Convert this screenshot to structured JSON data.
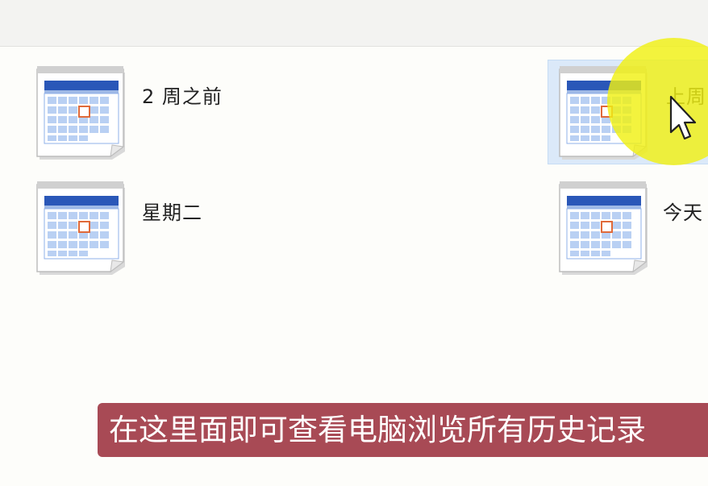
{
  "window": {
    "topbar": ""
  },
  "items": [
    {
      "label": "2 周之前",
      "icon": "calendar-icon"
    },
    {
      "label": "上周",
      "icon": "calendar-icon",
      "selected": true
    },
    {
      "label": "星期二",
      "icon": "calendar-icon"
    },
    {
      "label": "今天",
      "icon": "calendar-icon"
    }
  ],
  "subtitle": "在这里面即可查看电脑浏览所有历史记录",
  "colors": {
    "highlight": "#f0f014",
    "caption_bg": "#a84a55",
    "selection": "#dbe9f9"
  }
}
